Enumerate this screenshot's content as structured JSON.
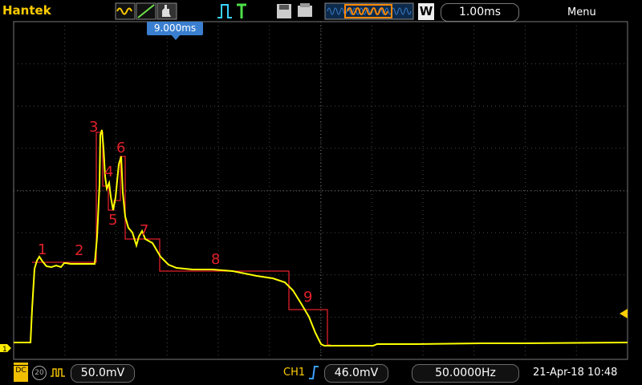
{
  "brand": "Hantek",
  "header": {
    "mode_letter": "W",
    "timebase": "1.00ms",
    "menu_label": "Menu",
    "trigger_time": "9.000ms",
    "icons": [
      "waveform-icon",
      "cursor-icon",
      "hand-icon",
      "pulse-icon",
      "trigger-t-icon",
      "save-icon",
      "print-icon",
      "memory-bar-icon"
    ]
  },
  "channel": {
    "marker": "1",
    "coupling_label": "DC",
    "probe_label": "20",
    "volts_div": "50.0mV",
    "trigger_source": "CH1",
    "trigger_level": "46.0mV",
    "frequency": "50.0000Hz",
    "datetime": "21-Apr-18 10:48"
  },
  "annotations": [
    "1",
    "2",
    "3",
    "4",
    "5",
    "6",
    "7",
    "8",
    "9"
  ],
  "colors": {
    "trace": "#ffff00",
    "annotation": "#e0202a",
    "grid": "#5a5a5a",
    "brand": "#ffcc00",
    "accent": "#3a7fd0"
  }
}
